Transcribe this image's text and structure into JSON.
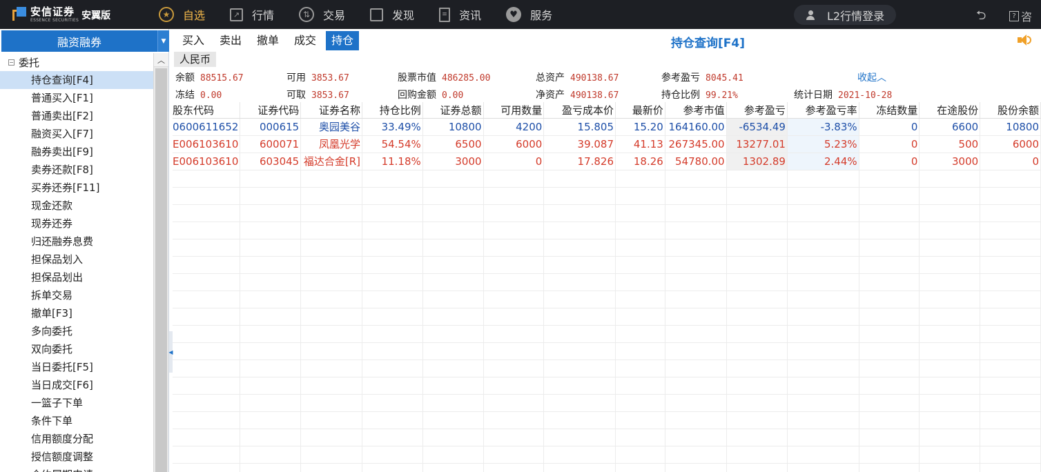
{
  "topbar": {
    "logo": {
      "name_cn": "安信证券",
      "name_en": "ESSENCE SECURITIES",
      "edition": "安翼版"
    },
    "nav": [
      {
        "label": "自选",
        "icon": "star-icon",
        "active": true
      },
      {
        "label": "行情",
        "icon": "chart-icon",
        "active": false
      },
      {
        "label": "交易",
        "icon": "trade-icon",
        "active": false
      },
      {
        "label": "发现",
        "icon": "grid-icon",
        "active": false
      },
      {
        "label": "资讯",
        "icon": "news-icon",
        "active": false
      },
      {
        "label": "服务",
        "icon": "service-icon",
        "active": false
      }
    ],
    "login_label": "L2行情登录",
    "help_label": "咨"
  },
  "sidebar": {
    "title": "融资融券",
    "root_label": "委托",
    "items": [
      {
        "label": "持仓查询[F4]",
        "selected": true
      },
      {
        "label": "普通买入[F1]"
      },
      {
        "label": "普通卖出[F2]"
      },
      {
        "label": "融资买入[F7]"
      },
      {
        "label": "融券卖出[F9]"
      },
      {
        "label": "卖券还款[F8]"
      },
      {
        "label": "买券还券[F11]"
      },
      {
        "label": "现金还款"
      },
      {
        "label": "现券还券"
      },
      {
        "label": "归还融券息费"
      },
      {
        "label": "担保品划入"
      },
      {
        "label": "担保品划出"
      },
      {
        "label": "拆单交易"
      },
      {
        "label": "撤单[F3]"
      },
      {
        "label": "多向委托"
      },
      {
        "label": "双向委托"
      },
      {
        "label": "当日委托[F5]"
      },
      {
        "label": "当日成交[F6]"
      },
      {
        "label": "一篮子下单"
      },
      {
        "label": "条件下单"
      },
      {
        "label": "信用额度分配"
      },
      {
        "label": "授信额度调整"
      },
      {
        "label": "合约展期申请"
      }
    ]
  },
  "tabs": [
    {
      "label": "买入",
      "active": false
    },
    {
      "label": "卖出",
      "active": false
    },
    {
      "label": "撤单",
      "active": false
    },
    {
      "label": "成交",
      "active": false
    },
    {
      "label": "持仓",
      "active": true
    }
  ],
  "page_title": "持仓查询[F4]",
  "currency": "人民币",
  "summary": {
    "balance": {
      "label": "余额",
      "value": "88515.67"
    },
    "available": {
      "label": "可用",
      "value": "3853.67"
    },
    "stock_value": {
      "label": "股票市值",
      "value": "486285.00"
    },
    "total_assets": {
      "label": "总资产",
      "value": "490138.67"
    },
    "ref_pnl": {
      "label": "参考盈亏",
      "value": "8045.41"
    },
    "collapse_label": "收起︿",
    "frozen": {
      "label": "冻结",
      "value": "0.00"
    },
    "withdrawable": {
      "label": "可取",
      "value": "3853.67"
    },
    "repo_amount": {
      "label": "回购金额",
      "value": "0.00"
    },
    "net_assets": {
      "label": "净资产",
      "value": "490138.67"
    },
    "position_ratio": {
      "label": "持仓比例",
      "value": "99.21%"
    },
    "stat_date": {
      "label": "统计日期",
      "value": "2021-10-28"
    }
  },
  "table": {
    "columns": [
      "股东代码",
      "证券代码",
      "证券名称",
      "持仓比例",
      "证券总额",
      "可用数量",
      "盈亏成本价",
      "最新价",
      "参考市值",
      "参考盈亏",
      "参考盈亏率",
      "冻结数量",
      "在途股份",
      "股份余额"
    ],
    "rows": [
      {
        "color": "blue",
        "cells": [
          "0600611652",
          "000615",
          "奥园美谷",
          "33.49%",
          "10800",
          "4200",
          "15.805",
          "15.20",
          "164160.00",
          "-6534.49",
          "-3.83%",
          "0",
          "6600",
          "10800"
        ]
      },
      {
        "color": "red",
        "cells": [
          "E006103610",
          "600071",
          "凤凰光学",
          "54.54%",
          "6500",
          "6000",
          "39.087",
          "41.13",
          "267345.00",
          "13277.01",
          "5.23%",
          "0",
          "500",
          "6000"
        ]
      },
      {
        "color": "red",
        "cells": [
          "E006103610",
          "603045",
          "福达合金[R]",
          "11.18%",
          "3000",
          "0",
          "17.826",
          "18.26",
          "54780.00",
          "1302.89",
          "2.44%",
          "0",
          "3000",
          "0"
        ]
      }
    ]
  }
}
